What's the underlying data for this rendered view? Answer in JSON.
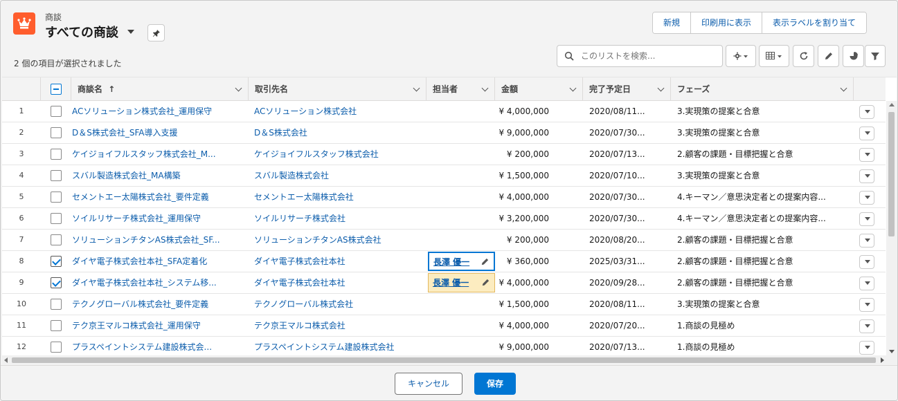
{
  "header": {
    "object_label": "商談",
    "list_title": "すべての商談",
    "selected_count": "2 個の項目が選択されました",
    "buttons": [
      "新規",
      "印刷用に表示",
      "表示ラベルを割り当て"
    ],
    "search_placeholder": "このリストを検索..."
  },
  "colors": {
    "brand": "#ff5d2d",
    "link": "#0b5cab",
    "primary": "#0176d3",
    "edited": "#fcecc0"
  },
  "table": {
    "columns": {
      "name": "商談名",
      "sort_icon": "↑",
      "account": "取引先名",
      "owner": "担当者",
      "amount": "金額",
      "close_date": "完了予定日",
      "stage": "フェーズ"
    },
    "rows": [
      {
        "num": "1",
        "name": "ACソリューション株式会社_運用保守",
        "account": "ACソリューション株式会社",
        "owner": "",
        "amount": "¥ 4,000,000",
        "date": "2020/08/11...",
        "stage": "3.実現策の提案と合意",
        "checked": false
      },
      {
        "num": "2",
        "name": "D＆S株式会社_SFA導入支援",
        "account": "D＆S株式会社",
        "owner": "",
        "amount": "¥ 9,000,000",
        "date": "2020/07/30...",
        "stage": "3.実現策の提案と合意",
        "checked": false
      },
      {
        "num": "3",
        "name": "ケイジョイフルスタッフ株式会社_M...",
        "account": "ケイジョイフルスタッフ株式会社",
        "owner": "",
        "amount": "¥ 200,000",
        "date": "2020/07/13...",
        "stage": "2.顧客の課題・目標把握と合意",
        "checked": false
      },
      {
        "num": "4",
        "name": "スバル製造株式会社_MA構築",
        "account": "スバル製造株式会社",
        "owner": "",
        "amount": "¥ 1,500,000",
        "date": "2020/07/10...",
        "stage": "3.実現策の提案と合意",
        "checked": false
      },
      {
        "num": "5",
        "name": "セメントエー太陽株式会社_要件定義",
        "account": "セメントエー太陽株式会社",
        "owner": "",
        "amount": "¥ 4,000,000",
        "date": "2020/07/30...",
        "stage": "4.キーマン／意思決定者との提案内容...",
        "checked": false
      },
      {
        "num": "6",
        "name": "ソイルリサーチ株式会社_運用保守",
        "account": "ソイルリサーチ株式会社",
        "owner": "",
        "amount": "¥ 3,200,000",
        "date": "2020/07/30...",
        "stage": "4.キーマン／意思決定者との提案内容...",
        "checked": false
      },
      {
        "num": "7",
        "name": "ソリューションチタンAS株式会社_SF...",
        "account": "ソリューションチタンAS株式会社",
        "owner": "",
        "amount": "¥ 200,000",
        "date": "2020/08/20...",
        "stage": "2.顧客の課題・目標把握と合意",
        "checked": false
      },
      {
        "num": "8",
        "name": "ダイヤ電子株式会社本社_SFA定着化",
        "account": "ダイヤ電子株式会社本社",
        "owner": "長澤 優一",
        "amount": "¥ 360,000",
        "date": "2025/03/31...",
        "stage": "2.顧客の課題・目標把握と合意",
        "checked": true
      },
      {
        "num": "9",
        "name": "ダイヤ電子株式会社本社_システム移...",
        "account": "ダイヤ電子株式会社本社",
        "owner": "長澤 優一",
        "amount": "¥ 4,000,000",
        "date": "2020/09/28...",
        "stage": "2.顧客の課題・目標把握と合意",
        "checked": true
      },
      {
        "num": "10",
        "name": "テクノグローバル株式会社_要件定義",
        "account": "テクノグローバル株式会社",
        "owner": "",
        "amount": "¥ 1,500,000",
        "date": "2020/08/11...",
        "stage": "3.実現策の提案と合意",
        "checked": false
      },
      {
        "num": "11",
        "name": "テク京王マルコ株式会社_運用保守",
        "account": "テク京王マルコ株式会社",
        "owner": "",
        "amount": "¥ 4,000,000",
        "date": "2020/07/20...",
        "stage": "1.商談の見極め",
        "checked": false
      },
      {
        "num": "12",
        "name": "プラスペイントシステム建設株式会...",
        "account": "プラスペイントシステム建設株式会社",
        "owner": "",
        "amount": "¥ 9,000,000",
        "date": "2020/07/13...",
        "stage": "1.商談の見極め",
        "checked": false
      }
    ]
  },
  "footer": {
    "cancel": "キャンセル",
    "save": "保存"
  }
}
